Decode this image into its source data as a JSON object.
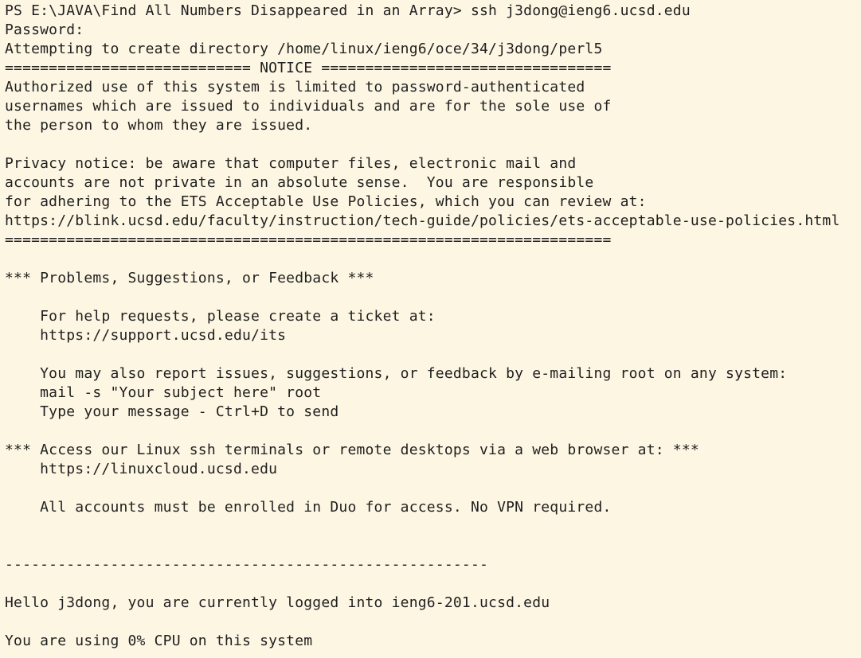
{
  "terminal": {
    "background_color": "#fdf6e3",
    "text_color": "#1f1f1f",
    "prompt": {
      "path": "PS E:\\JAVA\\Find All Numbers Disappeared in an Array>",
      "command": " ssh j3dong@ieng6.ucsd.edu"
    },
    "lines": [
      "Password:",
      "Attempting to create directory /home/linux/ieng6/oce/34/j3dong/perl5",
      "============================ NOTICE =================================",
      "Authorized use of this system is limited to password-authenticated",
      "usernames which are issued to individuals and are for the sole use of",
      "the person to whom they are issued.",
      "",
      "Privacy notice: be aware that computer files, electronic mail and",
      "accounts are not private in an absolute sense.  You are responsible",
      "for adhering to the ETS Acceptable Use Policies, which you can review at:",
      "https://blink.ucsd.edu/faculty/instruction/tech-guide/policies/ets-acceptable-use-policies.html",
      "=====================================================================",
      "",
      "*** Problems, Suggestions, or Feedback ***",
      "",
      "    For help requests, please create a ticket at:",
      "    https://support.ucsd.edu/its",
      "",
      "    You may also report issues, suggestions, or feedback by e-mailing root on any system:",
      "    mail -s \"Your subject here\" root",
      "    Type your message - Ctrl+D to send",
      "",
      "*** Access our Linux ssh terminals or remote desktops via a web browser at: ***",
      "    https://linuxcloud.ucsd.edu",
      "",
      "    All accounts must be enrolled in Duo for access. No VPN required.",
      "",
      "",
      "-------------------------------------------------------",
      "",
      "Hello j3dong, you are currently logged into ieng6-201.ucsd.edu",
      "",
      "You are using 0% CPU on this system"
    ]
  }
}
